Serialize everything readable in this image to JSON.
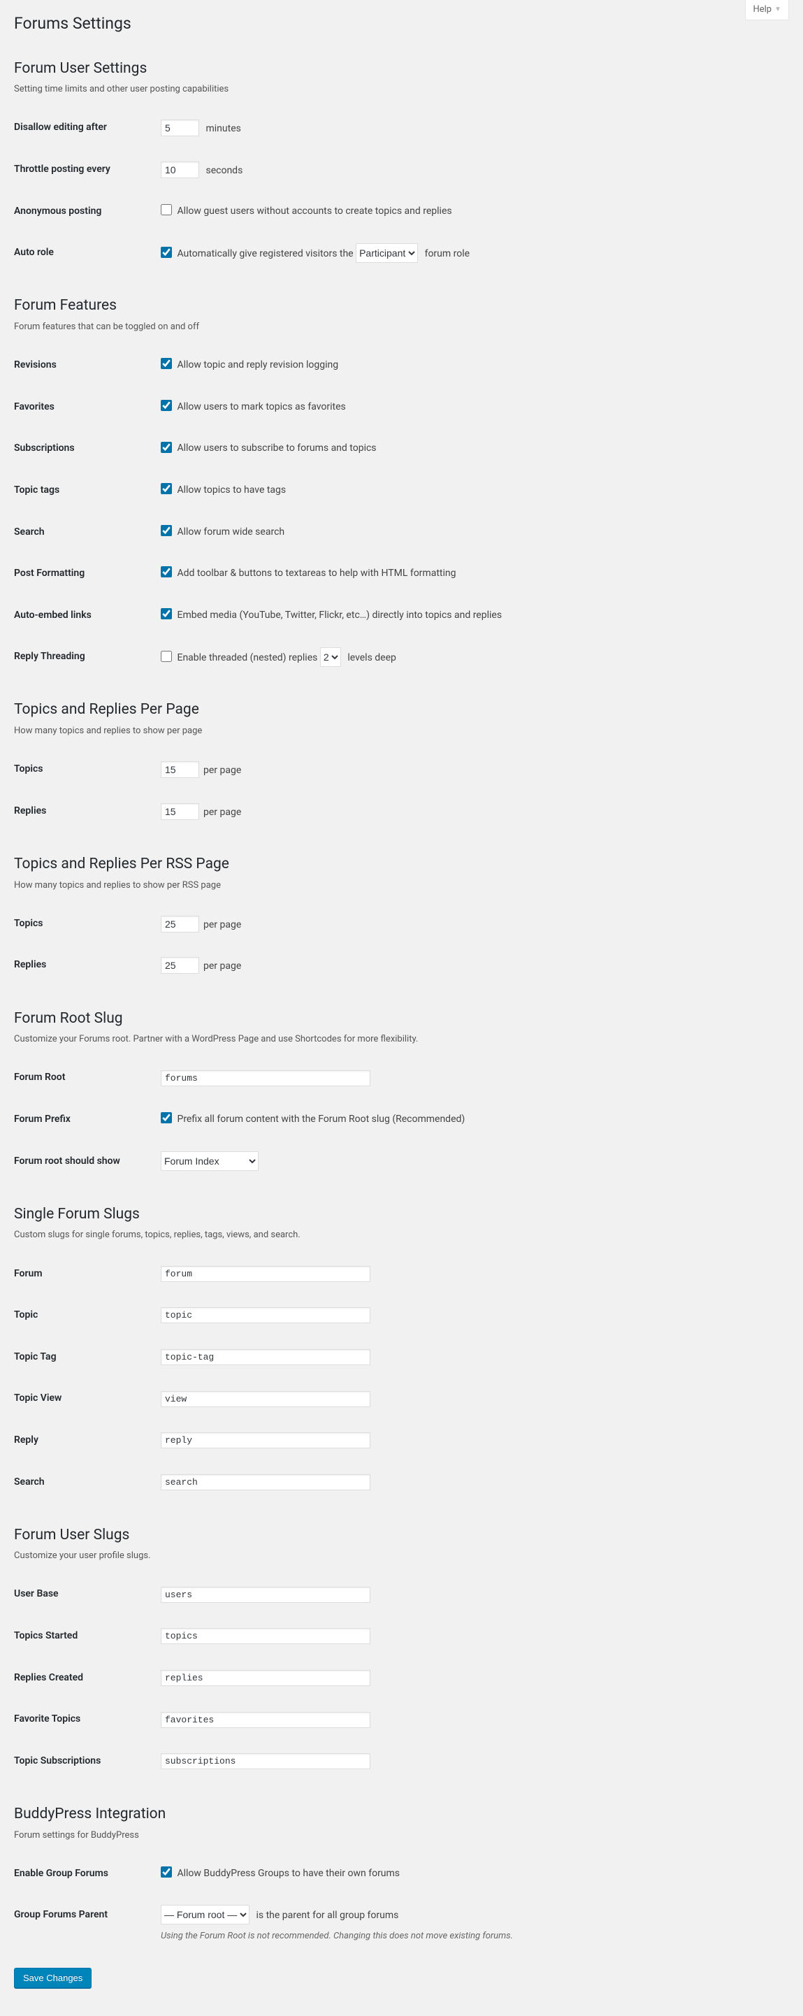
{
  "help_tab": "Help",
  "page_title": "Forums Settings",
  "sections": {
    "user_settings": {
      "heading": "Forum User Settings",
      "desc": "Setting time limits and other user posting capabilities",
      "rows": {
        "disallow_editing": {
          "label": "Disallow editing after",
          "value": "5",
          "suffix": "minutes"
        },
        "throttle": {
          "label": "Throttle posting every",
          "value": "10",
          "suffix": "seconds"
        },
        "anonymous": {
          "label": "Anonymous posting",
          "cb_label": "Allow guest users without accounts to create topics and replies",
          "checked": false
        },
        "auto_role": {
          "label": "Auto role",
          "cb_label_pre": "Automatically give registered visitors the",
          "cb_label_post": "forum role",
          "checked": true,
          "select": "Participant"
        }
      }
    },
    "features": {
      "heading": "Forum Features",
      "desc": "Forum features that can be toggled on and off",
      "rows": {
        "revisions": {
          "label": "Revisions",
          "cb_label": "Allow topic and reply revision logging",
          "checked": true
        },
        "favorites": {
          "label": "Favorites",
          "cb_label": "Allow users to mark topics as favorites",
          "checked": true
        },
        "subscriptions": {
          "label": "Subscriptions",
          "cb_label": "Allow users to subscribe to forums and topics",
          "checked": true
        },
        "topic_tags": {
          "label": "Topic tags",
          "cb_label": "Allow topics to have tags",
          "checked": true
        },
        "search": {
          "label": "Search",
          "cb_label": "Allow forum wide search",
          "checked": true
        },
        "post_formatting": {
          "label": "Post Formatting",
          "cb_label": "Add toolbar & buttons to textareas to help with HTML formatting",
          "checked": true
        },
        "auto_embed": {
          "label": "Auto-embed links",
          "cb_label": "Embed media (YouTube, Twitter, Flickr, etc…) directly into topics and replies",
          "checked": true
        },
        "threading": {
          "label": "Reply Threading",
          "cb_label_pre": "Enable threaded (nested) replies",
          "cb_label_post": "levels deep",
          "checked": false,
          "select": "2"
        }
      }
    },
    "per_page": {
      "heading": "Topics and Replies Per Page",
      "desc": "How many topics and replies to show per page",
      "rows": {
        "topics": {
          "label": "Topics",
          "value": "15",
          "suffix": "per page"
        },
        "replies": {
          "label": "Replies",
          "value": "15",
          "suffix": "per page"
        }
      }
    },
    "per_rss": {
      "heading": "Topics and Replies Per RSS Page",
      "desc": "How many topics and replies to show per RSS page",
      "rows": {
        "topics": {
          "label": "Topics",
          "value": "25",
          "suffix": "per page"
        },
        "replies": {
          "label": "Replies",
          "value": "25",
          "suffix": "per page"
        }
      }
    },
    "root_slug": {
      "heading": "Forum Root Slug",
      "desc": "Customize your Forums root. Partner with a WordPress Page and use Shortcodes for more flexibility.",
      "rows": {
        "forum_root": {
          "label": "Forum Root",
          "value": "forums"
        },
        "forum_prefix": {
          "label": "Forum Prefix",
          "cb_label": "Prefix all forum content with the Forum Root slug (Recommended)",
          "checked": true
        },
        "root_show": {
          "label": "Forum root should show",
          "select": "Forum Index"
        }
      }
    },
    "single_slugs": {
      "heading": "Single Forum Slugs",
      "desc": "Custom slugs for single forums, topics, replies, tags, views, and search.",
      "rows": {
        "forum": {
          "label": "Forum",
          "value": "forum"
        },
        "topic": {
          "label": "Topic",
          "value": "topic"
        },
        "topic_tag": {
          "label": "Topic Tag",
          "value": "topic-tag"
        },
        "topic_view": {
          "label": "Topic View",
          "value": "view"
        },
        "reply": {
          "label": "Reply",
          "value": "reply"
        },
        "search": {
          "label": "Search",
          "value": "search"
        }
      }
    },
    "user_slugs": {
      "heading": "Forum User Slugs",
      "desc": "Customize your user profile slugs.",
      "rows": {
        "user_base": {
          "label": "User Base",
          "value": "users"
        },
        "topics_started": {
          "label": "Topics Started",
          "value": "topics"
        },
        "replies_created": {
          "label": "Replies Created",
          "value": "replies"
        },
        "favorite_topics": {
          "label": "Favorite Topics",
          "value": "favorites"
        },
        "topic_subscriptions": {
          "label": "Topic Subscriptions",
          "value": "subscriptions"
        }
      }
    },
    "buddypress": {
      "heading": "BuddyPress Integration",
      "desc": "Forum settings for BuddyPress",
      "rows": {
        "enable_group": {
          "label": "Enable Group Forums",
          "cb_label": "Allow BuddyPress Groups to have their own forums",
          "checked": true
        },
        "group_parent": {
          "label": "Group Forums Parent",
          "select": "— Forum root —",
          "suffix": "is the parent for all group forums",
          "note": "Using the Forum Root is not recommended. Changing this does not move existing forums."
        }
      }
    }
  },
  "save_button": "Save Changes"
}
